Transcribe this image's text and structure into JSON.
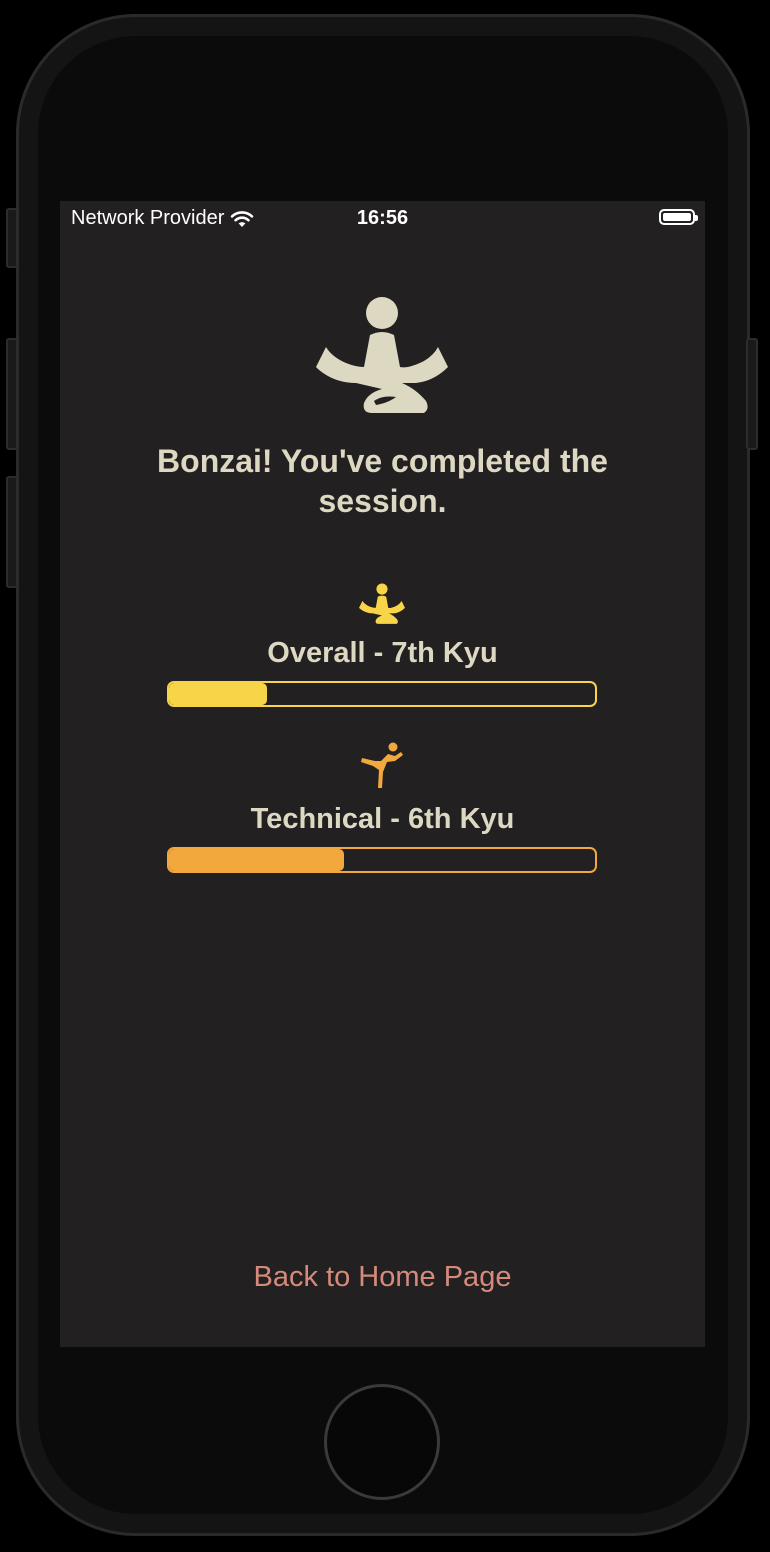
{
  "status_bar": {
    "carrier": "Network Provider",
    "time": "16:56",
    "wifi_icon": "wifi-icon",
    "battery_icon": "battery-icon"
  },
  "hero": {
    "icon": "meditation-icon",
    "headline": "Bonzai! You've completed the session."
  },
  "skills": [
    {
      "icon": "meditation-icon",
      "label": "Overall - 7th Kyu",
      "progress": 0.23,
      "color": "#f7d448"
    },
    {
      "icon": "martial-arts-kick-icon",
      "label": "Technical - 6th Kyu",
      "progress": 0.41,
      "color": "#f2a83c"
    }
  ],
  "actions": {
    "back_home_label": "Back to Home Page"
  },
  "colors": {
    "background": "#222021",
    "headline": "#ddd8c2",
    "link": "#d58a7c"
  }
}
